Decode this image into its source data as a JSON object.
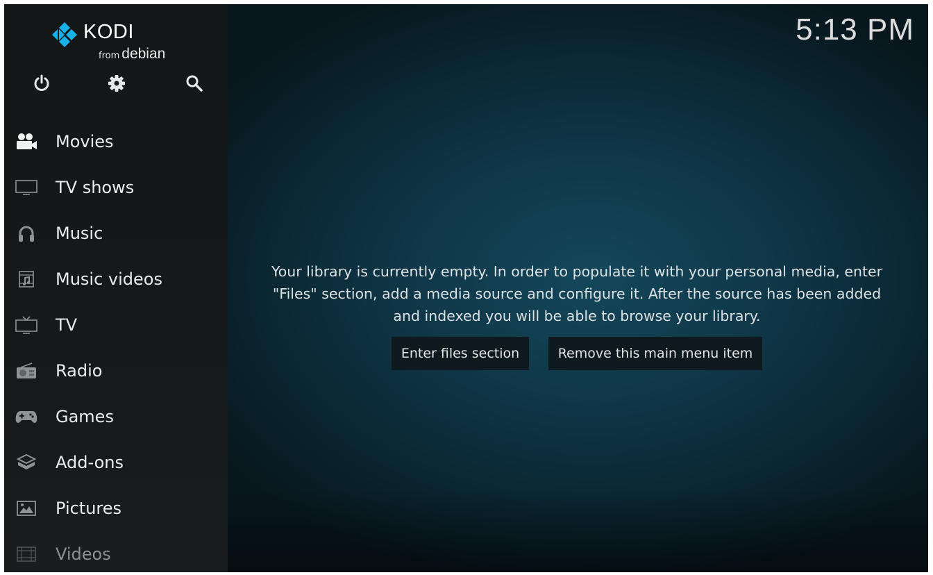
{
  "app": {
    "logo_text": "KODI",
    "logo_from": "from",
    "logo_distro": "debian",
    "clock": "5:13 PM"
  },
  "top_icons": [
    {
      "name": "power-icon"
    },
    {
      "name": "settings-icon"
    },
    {
      "name": "search-icon"
    }
  ],
  "menu": {
    "items": [
      {
        "label": "Movies",
        "icon": "movies-icon"
      },
      {
        "label": "TV shows",
        "icon": "tv-shows-icon"
      },
      {
        "label": "Music",
        "icon": "headphones-icon"
      },
      {
        "label": "Music videos",
        "icon": "music-videos-icon"
      },
      {
        "label": "TV",
        "icon": "tv-icon"
      },
      {
        "label": "Radio",
        "icon": "radio-icon"
      },
      {
        "label": "Games",
        "icon": "gamepad-icon"
      },
      {
        "label": "Add-ons",
        "icon": "addons-icon"
      },
      {
        "label": "Pictures",
        "icon": "pictures-icon"
      },
      {
        "label": "Videos",
        "icon": "videos-icon"
      }
    ]
  },
  "main": {
    "message_line1": "Your library is currently empty. In order to populate it with your personal media, enter",
    "message_line2": "\"Files\" section, add a media source and configure it. After the source has been added",
    "message_line3": "and indexed you will be able to browse your library.",
    "enter_files_label": "Enter files section",
    "remove_item_label": "Remove this main menu item"
  },
  "colors": {
    "logo_blue": "#17b2e7",
    "sidebar_bg": "#16191a",
    "main_bg": "#0f3748"
  }
}
